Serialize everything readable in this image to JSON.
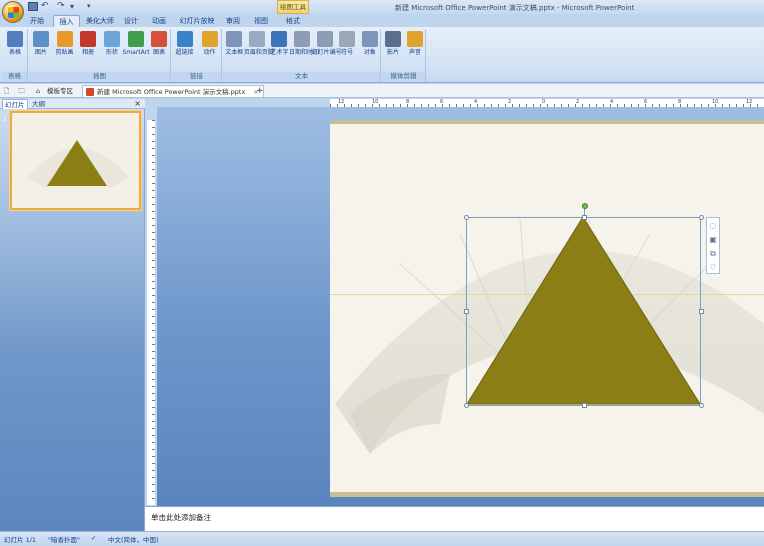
{
  "window": {
    "title": "新建 Microsoft Office PowerPoint 演示文稿.pptx - Microsoft PowerPoint",
    "contextual_tab": "绘图工具"
  },
  "quick_access": {
    "save": "save-icon",
    "undo": "↶",
    "redo": "↷",
    "more": "▾",
    "customize": "▾"
  },
  "tabs": [
    {
      "label": "开始"
    },
    {
      "label": "插入",
      "active": true
    },
    {
      "label": "美化大师"
    },
    {
      "label": "设计"
    },
    {
      "label": "动画"
    },
    {
      "label": "幻灯片放映"
    },
    {
      "label": "审阅"
    },
    {
      "label": "视图"
    },
    {
      "label": "格式"
    }
  ],
  "ribbon": {
    "groups": [
      {
        "label": "表格",
        "buttons": [
          {
            "label": "表格",
            "icon": "table-icon",
            "color": "#4f7fc1"
          }
        ]
      },
      {
        "label": "插图",
        "buttons": [
          {
            "label": "图片",
            "icon": "picture-icon",
            "color": "#5f8fc9"
          },
          {
            "label": "剪贴画",
            "icon": "clipart-icon",
            "color": "#e69a2c"
          },
          {
            "label": "相册",
            "icon": "album-icon",
            "color": "#c0392b"
          },
          {
            "label": "形状",
            "icon": "shapes-icon",
            "color": "#6aa4d8"
          },
          {
            "label": "SmartArt",
            "icon": "smartart-icon",
            "color": "#3f9e4d"
          },
          {
            "label": "图表",
            "icon": "chart-icon",
            "color": "#d6513a"
          }
        ]
      },
      {
        "label": "链接",
        "buttons": [
          {
            "label": "超链接",
            "icon": "hyperlink-icon",
            "color": "#3a83c7"
          },
          {
            "label": "动作",
            "icon": "action-icon",
            "color": "#e0a32e"
          }
        ]
      },
      {
        "label": "文本",
        "buttons": [
          {
            "label": "文本框",
            "icon": "textbox-icon",
            "color": "#7d95b6"
          },
          {
            "label": "页眉和页脚",
            "icon": "header-footer-icon",
            "color": "#9aaac2"
          },
          {
            "label": "艺术字",
            "icon": "wordart-icon",
            "color": "#3f73b9"
          },
          {
            "label": "日期和时间",
            "icon": "datetime-icon",
            "color": "#8c9db5"
          },
          {
            "label": "幻灯片编号",
            "icon": "slide-number-icon",
            "color": "#8c9db5"
          },
          {
            "label": "符号",
            "icon": "symbol-icon",
            "color": "#9aa7b8"
          },
          {
            "label": "对象",
            "icon": "object-icon",
            "color": "#7d95b6"
          }
        ]
      },
      {
        "label": "媒体剪辑",
        "buttons": [
          {
            "label": "影片",
            "icon": "movie-icon",
            "color": "#5b6f8c"
          },
          {
            "label": "声音",
            "icon": "sound-icon",
            "color": "#e0a32e"
          }
        ]
      }
    ]
  },
  "doc_tabs": {
    "template": "模板专区",
    "active": "新建 Microsoft Office PowerPoint 演示文稿.pptx",
    "add": "+"
  },
  "left_panel": {
    "tab_slides": "幻灯片",
    "tab_outline": "大纲",
    "close": "×",
    "thumb_number": "1"
  },
  "ruler": {
    "labels": [
      "12",
      "10",
      "8",
      "6",
      "4",
      "2",
      "0",
      "2",
      "4",
      "6",
      "8",
      "10",
      "12"
    ]
  },
  "slide": {
    "shape_color": "#8b7e14",
    "shape_border": "#6d6310"
  },
  "notes": {
    "placeholder": "单击此处添加备注"
  },
  "status": {
    "slide_info": "幻灯片 1/1",
    "theme": "\"暗香扑面\"",
    "language": "中文(简体，中国)"
  }
}
